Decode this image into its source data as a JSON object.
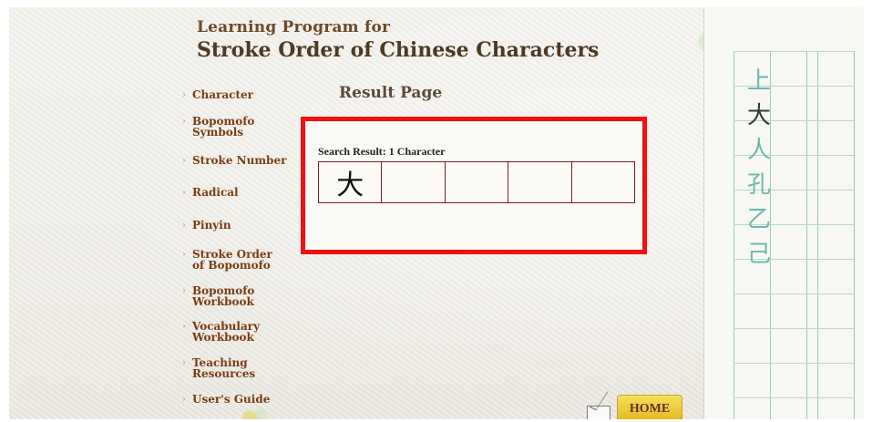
{
  "header": {
    "title_line1": "Learning Program for",
    "title_line2": "Stroke Order of Chinese Characters"
  },
  "nav": {
    "items": [
      {
        "label": "Character"
      },
      {
        "label": "Bopomofo\nSymbols"
      },
      {
        "label": "Stroke Number"
      },
      {
        "label": "Radical"
      },
      {
        "label": "Pinyin"
      },
      {
        "label": "Stroke Order\nof Bopomofo"
      },
      {
        "label": "Bopomofo\nWorkbook"
      },
      {
        "label": "Vocabulary\nWorkbook"
      },
      {
        "label": "Teaching\nResources"
      },
      {
        "label": "User's Guide"
      }
    ]
  },
  "result": {
    "page_title": "Result Page",
    "search_label": "Search Result: 1 Character",
    "cells": [
      "大",
      "",
      "",
      "",
      ""
    ]
  },
  "notebook": {
    "chars": [
      "上",
      "大",
      "人",
      "孔",
      "乙",
      "己"
    ]
  },
  "footer": {
    "home_label": "HOME"
  },
  "icons": {
    "pencil": "pencil-icon",
    "envelope": "envelope-icon"
  },
  "colors": {
    "highlight_border": "#ee1111",
    "nav_text": "#7a3c12",
    "grid_border": "#7a1f1f",
    "home_button": "#e2b51c"
  }
}
